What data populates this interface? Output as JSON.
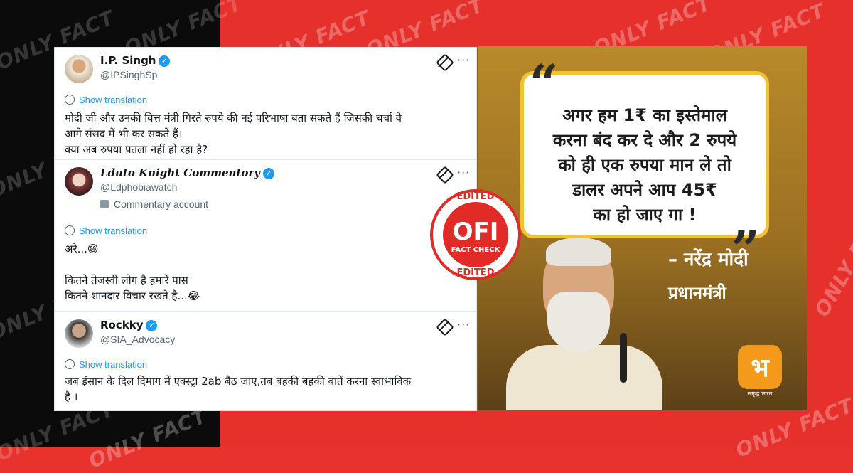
{
  "watermark": "ONLY FACT",
  "tweets": [
    {
      "name": "I.P. Singh",
      "handle": "@IPSinghSp",
      "translation": "Show translation",
      "text_lines": [
        "मोदी जी और उनकी वित्त मंत्री गिरते रुपये की नई परिभाषा बता सकते हैं जिसकी चर्चा वे",
        "आगे संसद में भी कर सकते हैं।",
        "क्या अब रुपया पतला नहीं हो रहा है?"
      ]
    },
    {
      "name": "Lduto Knight Commentory",
      "handle": "@Ldphobiawatch",
      "label": "Commentary account",
      "translation": "Show translation",
      "text_lines": [
        "अरे...😄",
        "",
        "कितने तेजस्वी लोग है हमारे पास",
        "कितने शानदार विचार रखते है...😂"
      ]
    },
    {
      "name": "Rockky",
      "handle": "@SIA_Advocacy",
      "translation": "Show translation",
      "text_lines": [
        "जब इंसान के दिल दिमाग में एक्स्ट्रा 2ab बैठ जाए,तब बहकी बहकी बातें करना स्वाभाविक",
        "है ।"
      ]
    }
  ],
  "stamp": {
    "top": "EDITED",
    "center": "OFI",
    "sub": "FACT CHECK",
    "bottom": "EDITED"
  },
  "poster": {
    "quote_lines": [
      "अगर हम 1₹ का इस्तेमाल",
      "करना बंद कर दे और 2 रुपये",
      "को ही एक रुपया मान ले तो",
      "डालर अपने आप 45₹",
      "का हो जाए गा !"
    ],
    "attribution_name": "– नरेंद्र मोदी",
    "attribution_role": "प्रधानमंत्री",
    "logo_char": "भ",
    "logo_sub": "समृद्ध भारत"
  },
  "colors": {
    "brand_red": "#e5302c",
    "verified_blue": "#1d9bf0",
    "quote_border": "#f2c230",
    "logo_orange": "#f39a1c"
  }
}
